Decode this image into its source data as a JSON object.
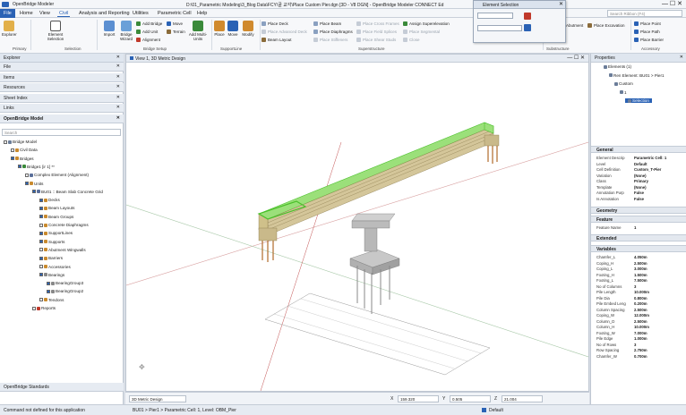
{
  "window": {
    "app_name": "OpenBridge Modeler",
    "title": "D:\\01_Parametric Modeling\\3_Blog Data\\FCY\\골 교각\\Place Custom Pier.dgn [3D - V8 DGN] - OpenBridge Modeler CONNECT Ed",
    "search_placeholder": "Search Ribbon (F4)"
  },
  "menu": [
    "File",
    "Home",
    "View",
    "Civil",
    "Analysis and Reporting",
    "Utilities",
    "Parametric Cell",
    "Help"
  ],
  "ribbon": {
    "explorer": "Explorer",
    "element_selection": "Element Selection",
    "import": "Import",
    "bridge_wizard": "Bridge Wizard",
    "add_bridge": "Add Bridge",
    "add_unit": "Add Unit",
    "alignment": "Alignment",
    "move": "Move",
    "terrain": "Terrain",
    "add_multi_units": "Add Multi-Units",
    "place": "Place",
    "move2": "Move",
    "modify": "Modify",
    "place_deck": "Place Deck",
    "place_advanced_deck": "Place Advanced Deck",
    "beam_layout": "Beam Layout",
    "place_beam": "Place Beam",
    "place_diaphragms": "Place Diaphragms",
    "place_stiffeners": "Place Stiffeners",
    "place_cross_frames": "Place Cross Frames",
    "place_field_splices": "Place Field Splices",
    "place_shear_studs": "Place Shear Studs",
    "assign_superelevation": "Assign Superelevation",
    "place_segmental": "Place Segmental",
    "close": "Close",
    "abutment": "Abutment",
    "place_excavation": "Place Excavation",
    "place_point": "Place Point",
    "place_path": "Place Path",
    "place_barrier": "Place Barrier",
    "groups": {
      "primary": "Primary",
      "selection": "Selection",
      "bridge_setup": "Bridge Setup",
      "supportline": "SupportLine",
      "superstructure": "Superstructure",
      "substructure": "Substructure",
      "accessory": "Accessory"
    }
  },
  "element_selection": {
    "title": "Element Selection"
  },
  "left_panel": {
    "header": "Explorer",
    "sections": [
      "File",
      "Items",
      "Resources",
      "Sheet Index",
      "Links",
      "OpenBridge Model"
    ],
    "search_placeholder": "Search",
    "footer": "OpenBridge Standards",
    "tree": [
      {
        "label": "Bridge Model",
        "depth": 0,
        "check": false,
        "color": "#6b7d99"
      },
      {
        "label": "Civil Data",
        "depth": 1,
        "check": false,
        "color": "#c98a2e"
      },
      {
        "label": "Bridges",
        "depth": 1,
        "check": true,
        "color": "#c98a2e"
      },
      {
        "label": "Bridge1 [ir 1] **",
        "depth": 2,
        "check": true,
        "color": "#3a8a3a"
      },
      {
        "label": "Complex Element (Alignment)",
        "depth": 3,
        "check": false,
        "color": "#5a6f9a"
      },
      {
        "label": "Units",
        "depth": 3,
        "check": true,
        "color": "#c98a2e"
      },
      {
        "label": "BU01 :: Beam Slab Concrete Grid",
        "depth": 4,
        "check": true,
        "color": "#5a6f9a"
      },
      {
        "label": "Decks",
        "depth": 5,
        "check": true,
        "color": "#c98a2e"
      },
      {
        "label": "Beam Layouts",
        "depth": 5,
        "check": true,
        "color": "#c98a2e"
      },
      {
        "label": "Beam Groups",
        "depth": 5,
        "check": true,
        "color": "#c98a2e"
      },
      {
        "label": "Concrete Diaphragms",
        "depth": 5,
        "check": false,
        "color": "#c98a2e"
      },
      {
        "label": "SupportLines",
        "depth": 5,
        "check": true,
        "color": "#c98a2e"
      },
      {
        "label": "Supports",
        "depth": 5,
        "check": true,
        "color": "#c98a2e"
      },
      {
        "label": "Abutment Wingwalls",
        "depth": 5,
        "check": false,
        "color": "#c98a2e"
      },
      {
        "label": "Barriers",
        "depth": 5,
        "check": true,
        "color": "#c98a2e"
      },
      {
        "label": "Accessories",
        "depth": 5,
        "check": false,
        "color": "#c98a2e"
      },
      {
        "label": "Bearings",
        "depth": 5,
        "check": true,
        "color": "#888888"
      },
      {
        "label": "BearingGroup3",
        "depth": 6,
        "check": true,
        "color": "#888888"
      },
      {
        "label": "BearingGroup2",
        "depth": 6,
        "check": true,
        "color": "#888888"
      },
      {
        "label": "Tendons",
        "depth": 5,
        "check": false,
        "color": "#c98a2e"
      },
      {
        "label": "Reports",
        "depth": 4,
        "check": false,
        "color": "#c0392b"
      }
    ]
  },
  "view": {
    "title": "View 1, 3D Metric Design"
  },
  "properties": {
    "header": "Properties",
    "tree": [
      {
        "label": "Elements (1)",
        "depth": 0
      },
      {
        "label": "Ren Element: BU01 > Pier1",
        "depth": 1
      },
      {
        "label": "Custom",
        "depth": 2
      },
      {
        "label": "1",
        "depth": 3
      },
      {
        "label": "Selection",
        "depth": 4
      }
    ],
    "general_title": "General",
    "general": [
      {
        "k": "Element Descrip",
        "v": "Parametric Cell: 1"
      },
      {
        "k": "Level",
        "v": "Default"
      },
      {
        "k": "Cell Definition",
        "v": "Custom_T-Pier"
      },
      {
        "k": "Variation",
        "v": "(None)"
      },
      {
        "k": "Class",
        "v": "Primary"
      },
      {
        "k": "Template",
        "v": "(None)"
      },
      {
        "k": "Annotation Purp",
        "v": "False"
      },
      {
        "k": "Is Annotation",
        "v": "False"
      }
    ],
    "geometry_title": "Geometry",
    "feature_title": "Feature",
    "feature": [
      {
        "k": "Feature Name",
        "v": "1"
      }
    ],
    "extended_title": "Extended",
    "variables_title": "Variables",
    "variables": [
      {
        "k": "Chamfer_L",
        "v": "4.050m"
      },
      {
        "k": "Coping_H",
        "v": "2.500m"
      },
      {
        "k": "Coping_L",
        "v": "3.000m"
      },
      {
        "k": "Footing_H",
        "v": "1.500m"
      },
      {
        "k": "Footing_L",
        "v": "7.500m"
      },
      {
        "k": "No of Columns",
        "v": "3"
      },
      {
        "k": "Pile Length",
        "v": "10.000m"
      },
      {
        "k": "Pile Dia",
        "v": "0.800m"
      },
      {
        "k": "Pile Embed Leng",
        "v": "0.200m"
      },
      {
        "k": "Column Spacing",
        "v": "2.500m"
      },
      {
        "k": "Coping_W",
        "v": "12.000m"
      },
      {
        "k": "Column_D",
        "v": "2.500m"
      },
      {
        "k": "Column_H",
        "v": "10.000m"
      },
      {
        "k": "Footing_W",
        "v": "7.000m"
      },
      {
        "k": "Pile Edge",
        "v": "1.000m"
      },
      {
        "k": "No of Rows",
        "v": "3"
      },
      {
        "k": "Row Spacing",
        "v": "2.750m"
      },
      {
        "k": "Chamfer_W",
        "v": "0.700m"
      }
    ]
  },
  "bottom_bar": {
    "view_name": "3D Metric Design",
    "x_label": "X",
    "x_value": "159.320",
    "y_label": "Y",
    "y_value": "0.505",
    "z_label": "Z",
    "z_value": "21.004"
  },
  "status": {
    "left": "Command not defined for this application",
    "center": "BU01 > Pier1 > Parametric Cell: 1, Level: OBM_Pier",
    "level": "Default",
    "colors": {
      "accent": "#2a62b5",
      "green": "#49c02a",
      "beam": "#c9b98a"
    }
  }
}
